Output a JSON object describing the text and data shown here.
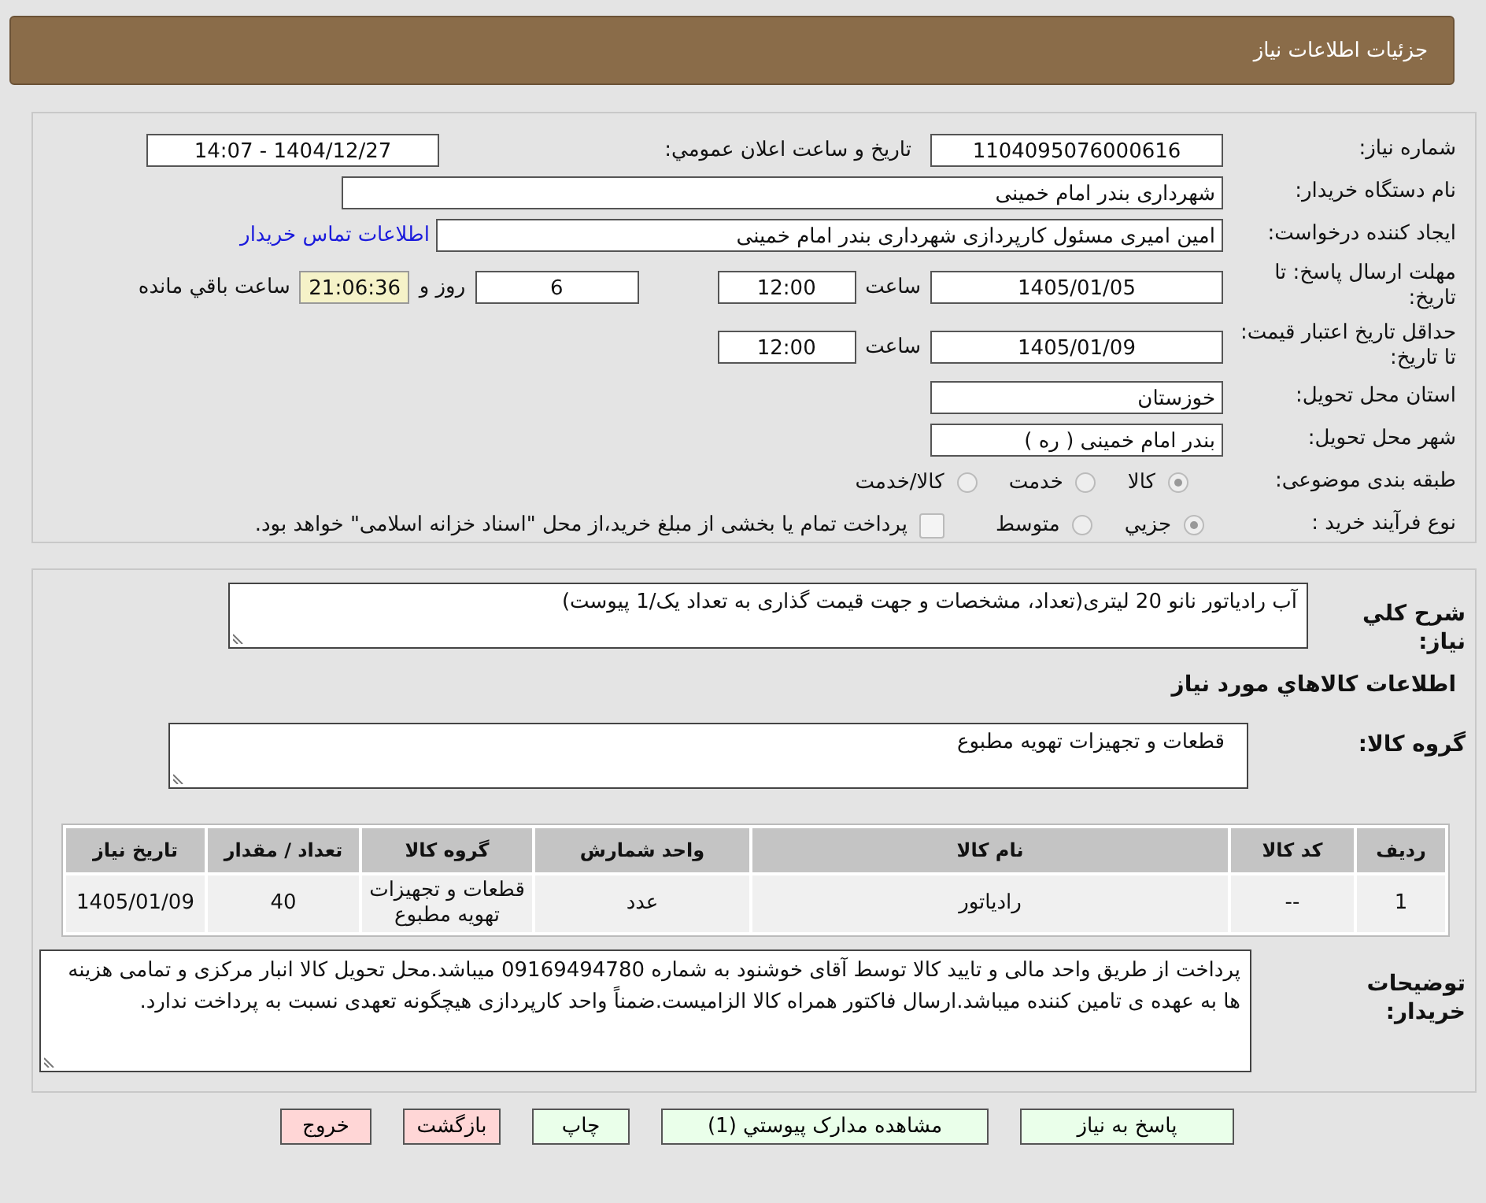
{
  "header": {
    "title": "جزئیات اطلاعات نیاز"
  },
  "need_number": {
    "label": "شماره نیاز:",
    "value": "1104095076000616"
  },
  "announce": {
    "label": "تاریخ و ساعت اعلان عمومي:",
    "value": "1404/12/27 - 14:07"
  },
  "buyer_org": {
    "label": "نام دستگاه خریدار:",
    "value": "شهرداری بندر امام خمینی"
  },
  "requester": {
    "label": "ایجاد کننده درخواست:",
    "value": "امین امیری مسئول کارپردازی شهرداری بندر امام خمینی",
    "link": "اطلاعات تماس خریدار"
  },
  "reply_deadline": {
    "label": "مهلت ارسال پاسخ: تا تاریخ:",
    "date": "1405/01/05",
    "time_label": "ساعت",
    "time": "12:00",
    "days": "6",
    "days_label": "روز و",
    "remaining": "21:06:36",
    "remaining_label": "ساعت باقي مانده"
  },
  "price_validity": {
    "label": "حداقل تاریخ اعتبار قیمت: تا تاریخ:",
    "date": "1405/01/09",
    "time_label": "ساعت",
    "time": "12:00"
  },
  "province": {
    "label": "استان محل تحویل:",
    "value": "خوزستان"
  },
  "city": {
    "label": "شهر محل تحویل:",
    "value": "بندر امام خمینی ( ره )"
  },
  "category": {
    "label": "طبقه بندی موضوعی:",
    "options": [
      {
        "label": "کالا",
        "selected": true
      },
      {
        "label": "خدمت",
        "selected": false
      },
      {
        "label": "کالا/خدمت",
        "selected": false
      }
    ]
  },
  "purchase_type": {
    "label": "نوع فرآیند خرید :",
    "options": [
      {
        "label": "جزيي",
        "selected": true
      },
      {
        "label": "متوسط",
        "selected": false
      }
    ],
    "treasury": {
      "checked": false,
      "text": "پرداخت تمام یا بخشی از مبلغ خرید،از محل \"اسناد خزانه اسلامی\" خواهد بود."
    }
  },
  "description": {
    "label": "شرح کلي نیاز:",
    "value": "آب رادیاتور نانو 20 لیتری(تعداد، مشخصات و جهت قیمت گذاری به تعداد یک/1 پیوست)"
  },
  "goods_heading": "اطلاعات کالاهاي مورد نیاز",
  "goods_group": {
    "label": "گروه کالا:",
    "value": "قطعات و تجهیزات تهویه مطبوع"
  },
  "table": {
    "columns": [
      "ردیف",
      "کد کالا",
      "نام کالا",
      "واحد شمارش",
      "گروه کالا",
      "تعداد / مقدار",
      "تاریخ نیاز"
    ],
    "rows": [
      [
        "1",
        "--",
        "رادیاتور",
        "عدد",
        "قطعات و تجهیزات تهویه مطبوع",
        "40",
        "1405/01/09"
      ]
    ]
  },
  "buyer_notes": {
    "label": "توضیحات خریدار:",
    "value": "پرداخت از طریق واحد مالی و تایید کالا توسط آقای خوشنود به شماره  09169494780 میباشد.محل تحویل کالا انبار مرکزی و تمامی هزینه ها به عهده ی تامین کننده میباشد.ارسال فاکتور همراه کالا الزامیست.ضمناً واحد کارپردازی هیچگونه تعهدی نسبت به پرداخت ندارد."
  },
  "buttons": [
    {
      "label": "پاسخ به نیاز",
      "kind": "action"
    },
    {
      "label": "مشاهده مدارک پیوستي (1)",
      "kind": "action"
    },
    {
      "label": "چاپ",
      "kind": "action"
    },
    {
      "label": "بازگشت",
      "kind": "exit"
    },
    {
      "label": "خروج",
      "kind": "exit"
    }
  ]
}
